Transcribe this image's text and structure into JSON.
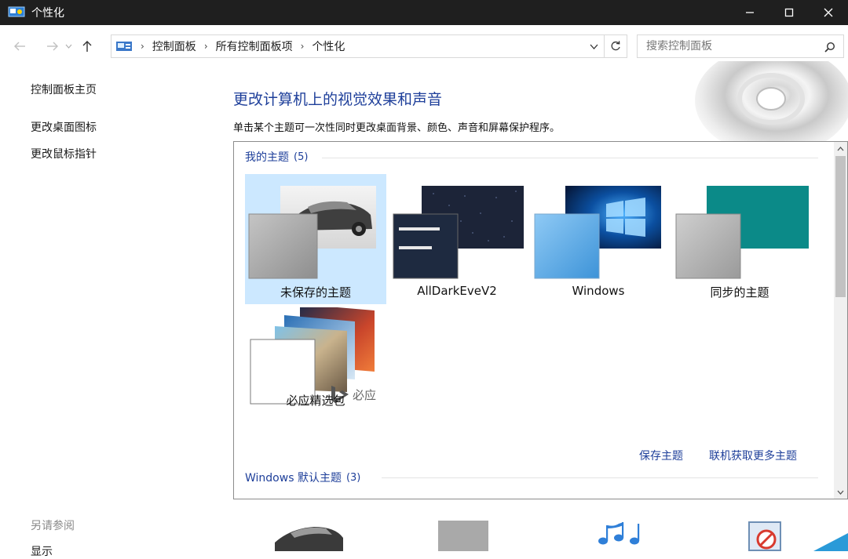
{
  "window": {
    "title": "个性化",
    "controls": [
      "minimize-icon",
      "maximize-icon",
      "close-icon"
    ]
  },
  "addressbar": {
    "breadcrumb": [
      "控制面板",
      "所有控制面板项",
      "个性化"
    ],
    "search_placeholder": "搜索控制面板"
  },
  "sidebar": {
    "home": "控制面板主页",
    "links": [
      "更改桌面图标",
      "更改鼠标指针"
    ],
    "see_also": "另请参阅",
    "display": "显示"
  },
  "main": {
    "title": "更改计算机上的视觉效果和声音",
    "description": "单击某个主题可一次性同时更改桌面背景、颜色、声音和屏幕保护程序。"
  },
  "themes": {
    "my_themes": {
      "label": "我的主题",
      "count": "(5)"
    },
    "items": [
      {
        "label": "未保存的主题",
        "selected": true
      },
      {
        "label": "AllDarkEveV2",
        "selected": false
      },
      {
        "label": "Windows",
        "selected": false
      },
      {
        "label": "同步的主题",
        "selected": false
      },
      {
        "label": "必应精选包",
        "selected": false,
        "badge": "必应"
      }
    ],
    "save_link": "保存主题",
    "online_link": "联机获取更多主题",
    "default_themes": {
      "label": "Windows 默认主题",
      "count": "(3)"
    }
  },
  "colors": {
    "titlebar": "#1f1f1f",
    "link_blue": "#1e3f9a",
    "selection": "#cce8ff",
    "teal": "#0b8a88"
  }
}
